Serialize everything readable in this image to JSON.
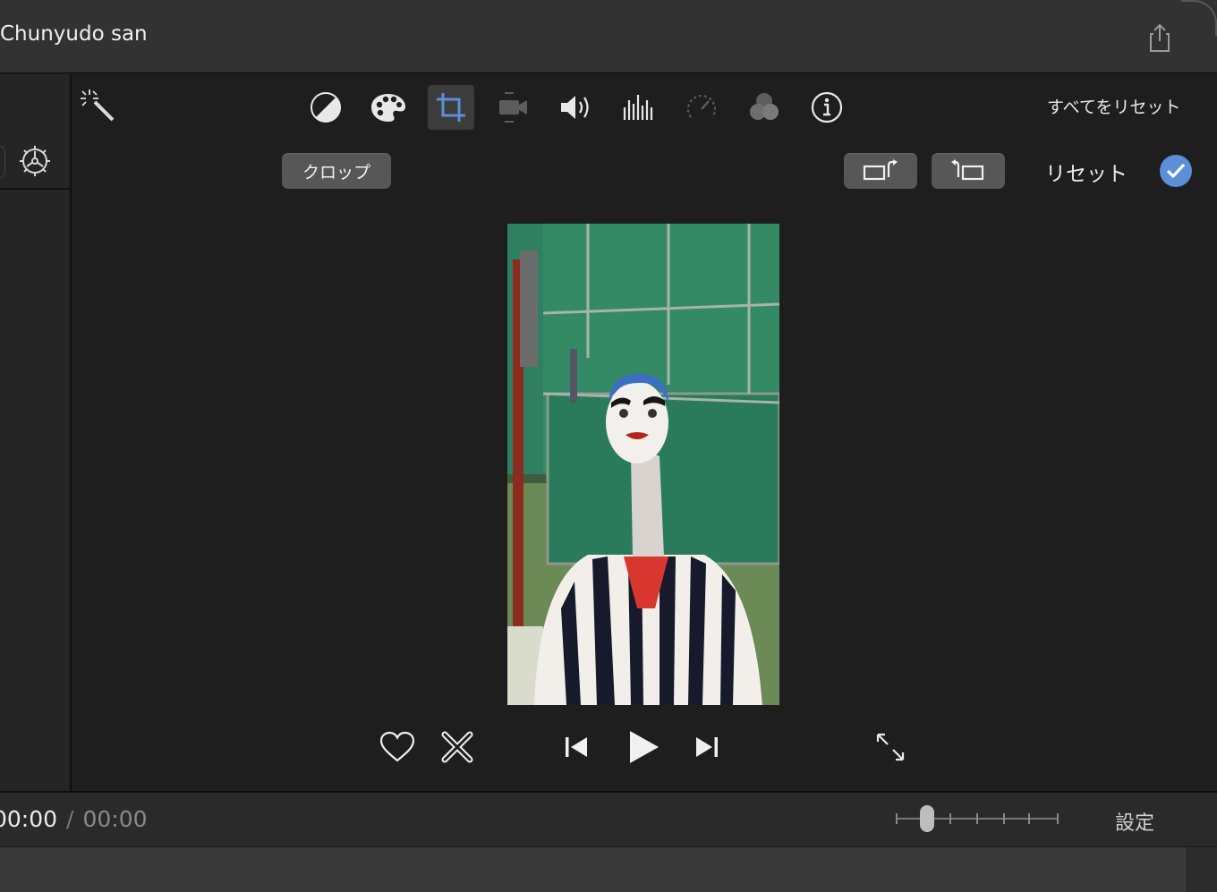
{
  "window": {
    "title": "Chunyudo san"
  },
  "toolbar": {
    "icons": [
      {
        "name": "magic-wand-icon"
      },
      {
        "name": "color-balance-icon"
      },
      {
        "name": "color-palette-icon"
      },
      {
        "name": "crop-icon",
        "active": true
      },
      {
        "name": "stabilization-camera-icon"
      },
      {
        "name": "volume-icon"
      },
      {
        "name": "equalizer-icon"
      },
      {
        "name": "speed-gauge-icon"
      },
      {
        "name": "video-overlay-icon"
      },
      {
        "name": "info-icon"
      }
    ],
    "reset_all_label": "すべてをリセット"
  },
  "crop_panel": {
    "crop_label": "クロップ",
    "reset_label": "リセット"
  },
  "playback": {
    "current_time": "00:00",
    "separator": "/",
    "total_time": "00:00"
  },
  "footer": {
    "settings_label": "設定"
  },
  "colors": {
    "accent": "#5b8fd6",
    "background": "#1e1e1e",
    "titlebar": "#323232"
  }
}
